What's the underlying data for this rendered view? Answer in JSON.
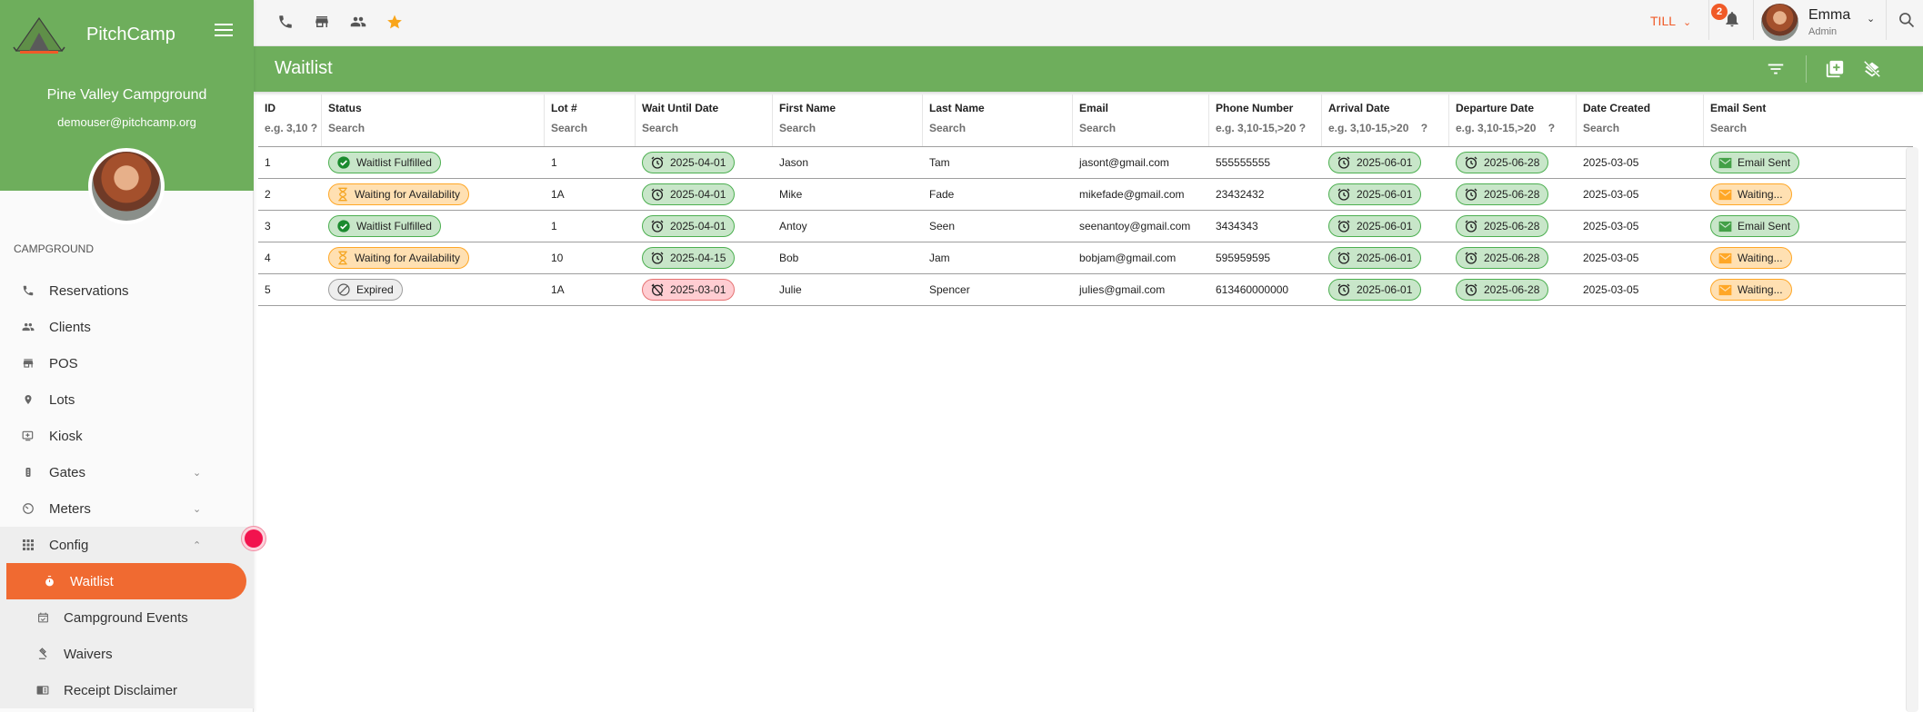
{
  "app": {
    "brand": "PitchCamp",
    "campground_name": "Pine Valley Campground",
    "user_email": "demouser@pitchcamp.org",
    "section_label": "CAMPGROUND"
  },
  "nav": {
    "items": [
      {
        "label": "Reservations",
        "icon": "phone-icon"
      },
      {
        "label": "Clients",
        "icon": "people-icon"
      },
      {
        "label": "POS",
        "icon": "store-icon"
      },
      {
        "label": "Lots",
        "icon": "map-pin-icon"
      },
      {
        "label": "Kiosk",
        "icon": "kiosk-icon"
      },
      {
        "label": "Gates",
        "icon": "traffic-light-icon",
        "expandable": true
      },
      {
        "label": "Meters",
        "icon": "meter-icon",
        "expandable": true
      },
      {
        "label": "Config",
        "icon": "grid-icon",
        "expanded": true
      }
    ],
    "config_children": [
      {
        "label": "Waitlist",
        "icon": "stopwatch-icon",
        "active": true
      },
      {
        "label": "Campground Events",
        "icon": "calendar-check-icon"
      },
      {
        "label": "Waivers",
        "icon": "gavel-icon"
      },
      {
        "label": "Receipt Disclaimer",
        "icon": "receipt-icon"
      }
    ]
  },
  "topbar": {
    "till_label": "TILL",
    "notification_count": "2",
    "user_name": "Emma",
    "user_role": "Admin",
    "accent": "#f05a28",
    "star_color": "#f9a51a"
  },
  "page": {
    "title": "Waitlist",
    "header_color": "#6eae5c"
  },
  "table": {
    "columns": [
      {
        "title": "ID",
        "filter": "e.g. 3,10 ?"
      },
      {
        "title": "Status",
        "filter": "Search"
      },
      {
        "title": "Lot #",
        "filter": "Search"
      },
      {
        "title": "Wait Until Date",
        "filter": "Search"
      },
      {
        "title": "First Name",
        "filter": "Search"
      },
      {
        "title": "Last Name",
        "filter": "Search"
      },
      {
        "title": "Email",
        "filter": "Search"
      },
      {
        "title": "Phone Number",
        "filter": "e.g. 3,10-15,>20 ?"
      },
      {
        "title": "Arrival Date",
        "filter": "e.g. 3,10-15,>20    ?"
      },
      {
        "title": "Departure Date",
        "filter": "e.g. 3,10-15,>20    ?"
      },
      {
        "title": "Date Created",
        "filter": "Search"
      },
      {
        "title": "Email Sent",
        "filter": "Search"
      }
    ],
    "rows": [
      {
        "id": "1",
        "status": "Waitlist Fulfilled",
        "status_type": "fulfilled",
        "lot": "1",
        "wait_until": "2025-04-01",
        "wait_expired": false,
        "first_name": "Jason",
        "last_name": "Tam",
        "email": "jasont@gmail.com",
        "phone": "555555555",
        "arrival": "2025-06-01",
        "departure": "2025-06-28",
        "created": "2025-03-05",
        "email_sent": "Email Sent",
        "email_sent_type": "sent"
      },
      {
        "id": "2",
        "status": "Waiting for Availability",
        "status_type": "waiting",
        "lot": "1A",
        "wait_until": "2025-04-01",
        "wait_expired": false,
        "first_name": "Mike",
        "last_name": "Fade",
        "email": "mikefade@gmail.com",
        "phone": "23432432",
        "arrival": "2025-06-01",
        "departure": "2025-06-28",
        "created": "2025-03-05",
        "email_sent": "Waiting...",
        "email_sent_type": "waiting"
      },
      {
        "id": "3",
        "status": "Waitlist Fulfilled",
        "status_type": "fulfilled",
        "lot": "1",
        "wait_until": "2025-04-01",
        "wait_expired": false,
        "first_name": "Antoy",
        "last_name": "Seen",
        "email": "seenantoy@gmail.com",
        "phone": "3434343",
        "arrival": "2025-06-01",
        "departure": "2025-06-28",
        "created": "2025-03-05",
        "email_sent": "Email Sent",
        "email_sent_type": "sent"
      },
      {
        "id": "4",
        "status": "Waiting for Availability",
        "status_type": "waiting",
        "lot": "10",
        "wait_until": "2025-04-15",
        "wait_expired": false,
        "first_name": "Bob",
        "last_name": "Jam",
        "email": "bobjam@gmail.com",
        "phone": "595959595",
        "arrival": "2025-06-01",
        "departure": "2025-06-28",
        "created": "2025-03-05",
        "email_sent": "Waiting...",
        "email_sent_type": "waiting"
      },
      {
        "id": "5",
        "status": "Expired",
        "status_type": "expired",
        "lot": "1A",
        "wait_until": "2025-03-01",
        "wait_expired": true,
        "first_name": "Julie",
        "last_name": "Spencer",
        "email": "julies@gmail.com",
        "phone": "613460000000",
        "arrival": "2025-06-01",
        "departure": "2025-06-28",
        "created": "2025-03-05",
        "email_sent": "Waiting...",
        "email_sent_type": "waiting"
      }
    ]
  }
}
